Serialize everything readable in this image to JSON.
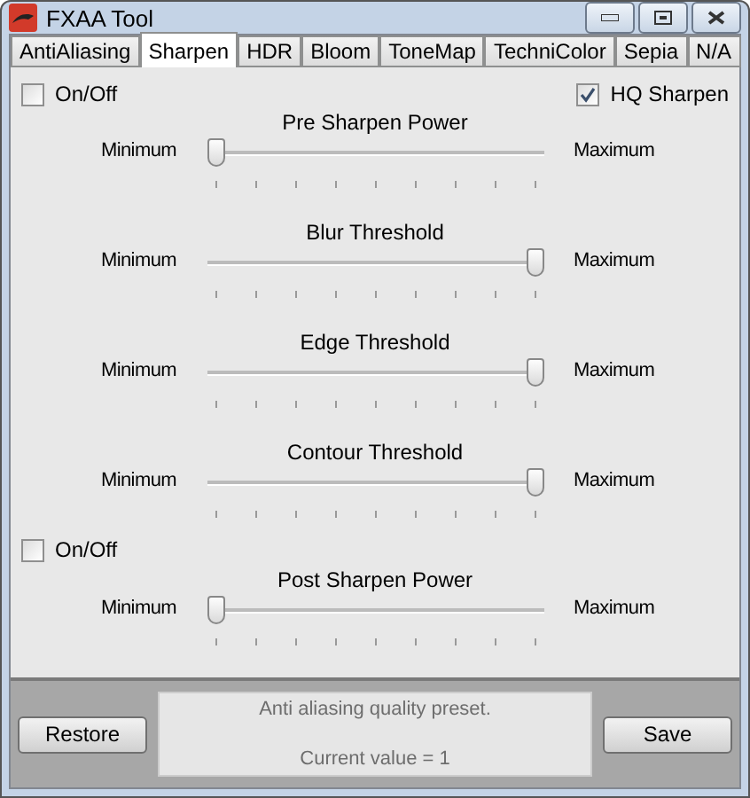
{
  "window": {
    "title": "FXAA Tool"
  },
  "tabs": [
    {
      "label": "AntiAliasing",
      "selected": false
    },
    {
      "label": "Sharpen",
      "selected": true
    },
    {
      "label": "HDR",
      "selected": false
    },
    {
      "label": "Bloom",
      "selected": false
    },
    {
      "label": "ToneMap",
      "selected": false
    },
    {
      "label": "TechniColor",
      "selected": false
    },
    {
      "label": "Sepia",
      "selected": false
    },
    {
      "label": "N/A",
      "selected": false
    }
  ],
  "top_options": [
    {
      "label": "On/Off",
      "checked": false
    },
    {
      "label": "HQ Sharpen",
      "checked": true
    }
  ],
  "controls": [
    {
      "kind": "slider",
      "title": "Pre Sharpen Power",
      "min_label": "Minimum",
      "max_label": "Maximum",
      "level": 0
    },
    {
      "kind": "slider",
      "title": "Blur Threshold",
      "min_label": "Minimum",
      "max_label": "Maximum",
      "level": 1
    },
    {
      "kind": "slider",
      "title": "Edge Threshold",
      "min_label": "Minimum",
      "max_label": "Maximum",
      "level": 1
    },
    {
      "kind": "slider",
      "title": "Contour Threshold",
      "min_label": "Minimum",
      "max_label": "Maximum",
      "level": 1
    },
    {
      "kind": "checkbox",
      "label": "On/Off",
      "checked": false
    },
    {
      "kind": "slider",
      "title": "Post Sharpen Power",
      "min_label": "Minimum",
      "max_label": "Maximum",
      "level": 0
    }
  ],
  "footer": {
    "restore": "Restore",
    "info": [
      "Anti aliasing quality preset.",
      "Current value = 1"
    ],
    "save": "Save"
  }
}
